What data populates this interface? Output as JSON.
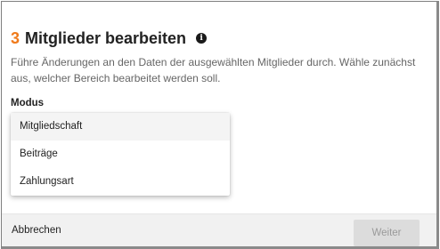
{
  "dialog": {
    "step_number": "3",
    "title": "Mitglieder bearbeiten",
    "info_icon": "info-icon",
    "info_glyph": "i",
    "description": "Führe Änderungen an den Daten der ausgewählten Mitglieder durch. Wähle zunächst aus, welcher Bereich bearbeitet werden soll."
  },
  "modus": {
    "label": "Modus",
    "options": [
      {
        "label": "Mitgliedschaft"
      },
      {
        "label": "Beiträge"
      },
      {
        "label": "Zahlungsart"
      }
    ]
  },
  "footer": {
    "cancel_label": "Abbrechen",
    "next_label": "Weiter",
    "next_disabled": true
  },
  "colors": {
    "accent": "#f07a1a",
    "disabled_button_bg": "#dcdcdc",
    "disabled_button_text": "#9a9a9a",
    "footer_bg": "#f1f1f1"
  }
}
